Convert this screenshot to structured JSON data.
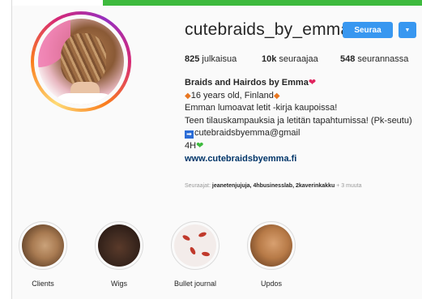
{
  "profile": {
    "username": "cutebraids_by_emma",
    "follow_label": "Seuraa",
    "dropdown_icon": "chevron-down-icon"
  },
  "stats": {
    "posts_count": "825",
    "posts_label": "julkaisua",
    "followers_count": "10k",
    "followers_label": "seuraajaa",
    "following_count": "548",
    "following_label": "seurannassa"
  },
  "bio": {
    "name": "Braids and Hairdos by Emma",
    "line1": "16 years old, Finland",
    "line2": "Emman lumoavat letit -kirja kaupoissa!",
    "line3": "Teen tilauskampauksia ja letitän tapahtumissa! (Pk-seutu)",
    "line4": "cutebraidsbyemma@gmail",
    "line5": "4H",
    "link": "www.cutebraidsbyemma.fi"
  },
  "followed_by": {
    "prefix": "Seuraajat:",
    "names": "jeanetenjujuja, 4hbusinesslab, 2kaverinkakku",
    "more": "+ 3 muuta"
  },
  "highlights": [
    {
      "label": "Clients"
    },
    {
      "label": "Wigs"
    },
    {
      "label": "Bullet journal"
    },
    {
      "label": "Updos"
    }
  ],
  "colors": {
    "accent": "#3897f0",
    "top_bar": "#3dba3d",
    "link": "#003569"
  }
}
